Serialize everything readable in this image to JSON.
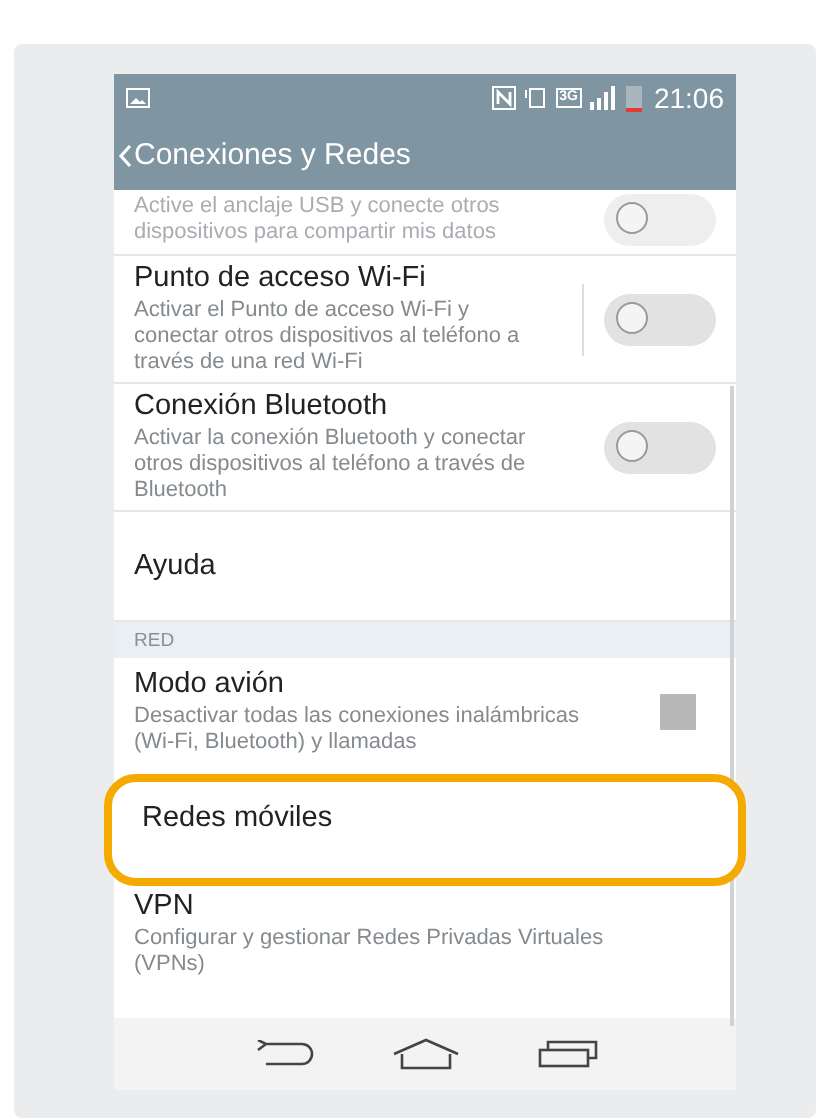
{
  "status_bar": {
    "network_type": "3G",
    "time": "21:06"
  },
  "header": {
    "title": "Conexiones y Redes"
  },
  "items": [
    {
      "kind": "partial",
      "subtitle": "Active el anclaje USB y conecte otros dispositivos para compartir mis datos",
      "on": false
    },
    {
      "kind": "toggle",
      "title": "Punto de acceso Wi-Fi",
      "subtitle": "Activar el Punto de acceso Wi-Fi y conectar otros dispositivos al teléfono a través de una red Wi-Fi",
      "on": false,
      "divider": true
    },
    {
      "kind": "toggle",
      "title": "Conexión Bluetooth",
      "subtitle": "Activar la conexión Bluetooth y conectar otros dispositivos al teléfono a través de Bluetooth",
      "on": false,
      "divider": false
    },
    {
      "kind": "plain",
      "title": "Ayuda"
    },
    {
      "kind": "section",
      "title": "RED"
    },
    {
      "kind": "checkbox",
      "title": "Modo avión",
      "subtitle": "Desactivar todas las conexiones inalámbricas (Wi-Fi, Bluetooth) y llamadas",
      "checked": false
    },
    {
      "kind": "plain",
      "title": "Redes móviles",
      "highlighted": true
    },
    {
      "kind": "plain",
      "title": "VPN",
      "subtitle": "Configurar y gestionar Redes Privadas Virtuales (VPNs)"
    }
  ]
}
